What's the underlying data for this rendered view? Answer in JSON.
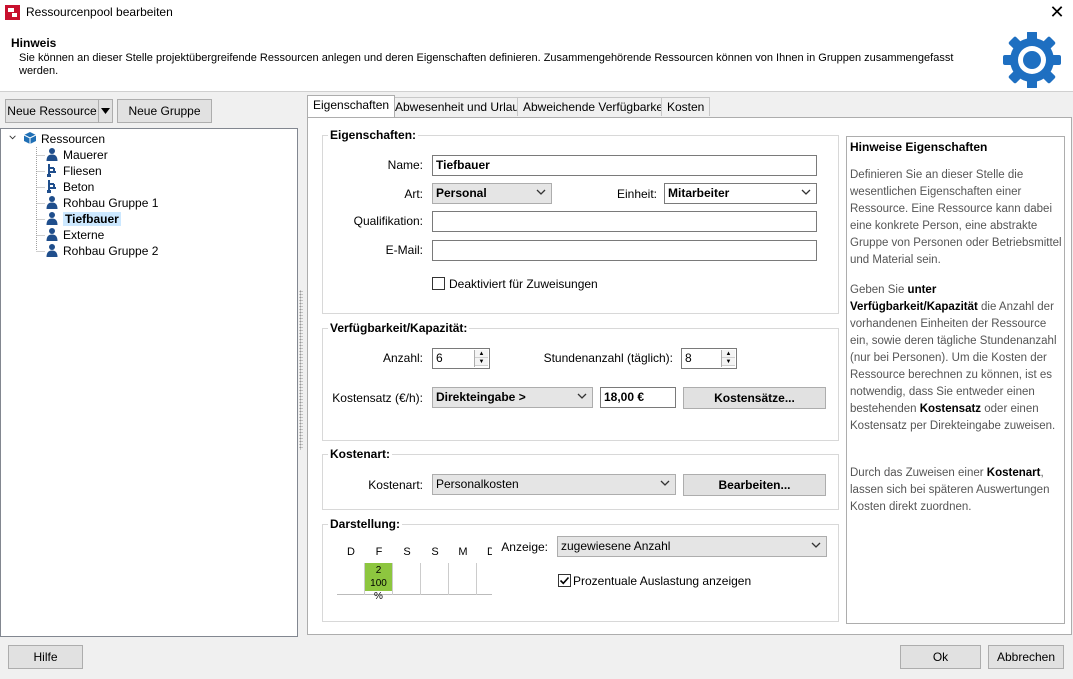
{
  "window": {
    "title": "Ressourcenpool bearbeiten"
  },
  "header": {
    "title": "Hinweis",
    "text": "Sie können an dieser Stelle projektübergreifende Ressourcen anlegen und deren Eigenschaften definieren. Zusammengehörende Ressourcen können von Ihnen in Gruppen zusammengefasst werden."
  },
  "toolbar": {
    "new_resource": "Neue Ressource",
    "new_group": "Neue Gruppe"
  },
  "tree": {
    "root": "Ressourcen",
    "items": [
      {
        "label": "Mauerer",
        "icon": "person-icon"
      },
      {
        "label": "Fliesen",
        "icon": "equipment-icon"
      },
      {
        "label": "Beton",
        "icon": "equipment-icon"
      },
      {
        "label": "Rohbau Gruppe 1",
        "icon": "person-icon"
      },
      {
        "label": "Tiefbauer",
        "icon": "person-icon",
        "selected": true
      },
      {
        "label": "Externe",
        "icon": "person-icon"
      },
      {
        "label": "Rohbau Gruppe 2",
        "icon": "person-icon"
      }
    ]
  },
  "tabs": [
    "Eigenschaften",
    "Abwesenheit und Urlaub",
    "Abweichende Verfügbarkeit",
    "Kosten"
  ],
  "props": {
    "group_title": "Eigenschaften:",
    "name_label": "Name:",
    "name_value": "Tiefbauer",
    "art_label": "Art:",
    "art_value": "Personal",
    "einheit_label": "Einheit:",
    "einheit_value": "Mitarbeiter",
    "qual_label": "Qualifikation:",
    "qual_value": "",
    "email_label": "E-Mail:",
    "email_value": "",
    "deactivated_label": "Deaktiviert für Zuweisungen"
  },
  "avail": {
    "group_title": "Verfügbarkeit/Kapazität:",
    "anzahl_label": "Anzahl:",
    "anzahl_value": "6",
    "stunden_label": "Stundenanzahl (täglich):",
    "stunden_value": "8",
    "kostensatz_label": "Kostensatz (€/h):",
    "kostensatz_mode": "Direkteingabe >",
    "kostensatz_value": "18,00 €",
    "kostensaetze_button": "Kostensätze..."
  },
  "kostenart": {
    "group_title": "Kostenart:",
    "label": "Kostenart:",
    "value": "Personalkosten",
    "edit_button": "Bearbeiten..."
  },
  "darstellung": {
    "group_title": "Darstellung:",
    "days": [
      "D",
      "F",
      "S",
      "S",
      "M",
      "D"
    ],
    "cell_count": "2",
    "cell_percent": "100 %",
    "anzeige_label": "Anzeige:",
    "anzeige_value": "zugewiesene Anzahl",
    "percent_checkbox_label": "Prozentuale Auslastung anzeigen"
  },
  "hints": {
    "title": "Hinweise Eigenschaften",
    "p1": "Definieren Sie an dieser Stelle die wesentlichen Eigenschaften einer Ressource. Eine Ressource kann dabei eine konkrete Person, eine abstrakte Gruppe von Personen oder Betriebsmittel und Material sein.",
    "p2_a": "Geben Sie ",
    "p2_b": "unter Verfügbarkeit/Kapazität",
    "p2_c": " die Anzahl der vorhandenen Einheiten der Ressource ein, sowie deren tägliche Stundenanzahl (nur bei Personen). Um die Kosten der Ressource berechnen zu können, ist es notwendig, dass Sie entweder einen bestehenden ",
    "p2_d": "Kostensatz",
    "p2_e": " oder einen Kostensatz per Direkteingabe zuweisen.",
    "p3_a": "Durch das Zuweisen einer ",
    "p3_b": "Kostenart",
    "p3_c": ", lassen sich bei späteren Auswertungen Kosten direkt zuordnen."
  },
  "footer": {
    "help": "Hilfe",
    "ok": "Ok",
    "cancel": "Abbrechen"
  },
  "colors": {
    "accent_blue": "#1e6fc1",
    "selection": "#cce8ff",
    "calendar_green": "#8dc63f",
    "person_blue": "#1f4e8c"
  }
}
